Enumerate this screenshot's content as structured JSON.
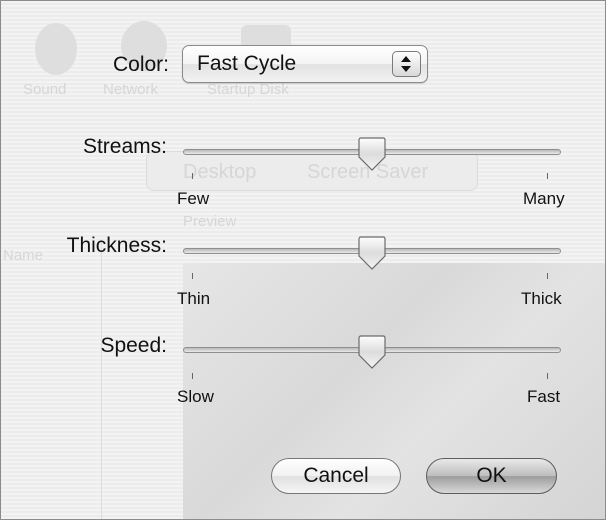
{
  "background": {
    "items": [
      "Sound",
      "Network",
      "Startup Disk"
    ],
    "tabs": [
      "Desktop",
      "Screen Saver"
    ],
    "preview_label": "Preview",
    "side_label": "Name"
  },
  "color": {
    "label": "Color:",
    "selected": "Fast Cycle"
  },
  "streams": {
    "label": "Streams:",
    "min_label": "Few",
    "max_label": "Many",
    "value": 0.5
  },
  "thickness": {
    "label": "Thickness:",
    "min_label": "Thin",
    "max_label": "Thick",
    "value": 0.5
  },
  "speed": {
    "label": "Speed:",
    "min_label": "Slow",
    "max_label": "Fast",
    "value": 0.5
  },
  "buttons": {
    "cancel": "Cancel",
    "ok": "OK"
  },
  "icons": {
    "popup": "up-down-arrows-icon",
    "thumb": "slider-thumb-icon"
  }
}
